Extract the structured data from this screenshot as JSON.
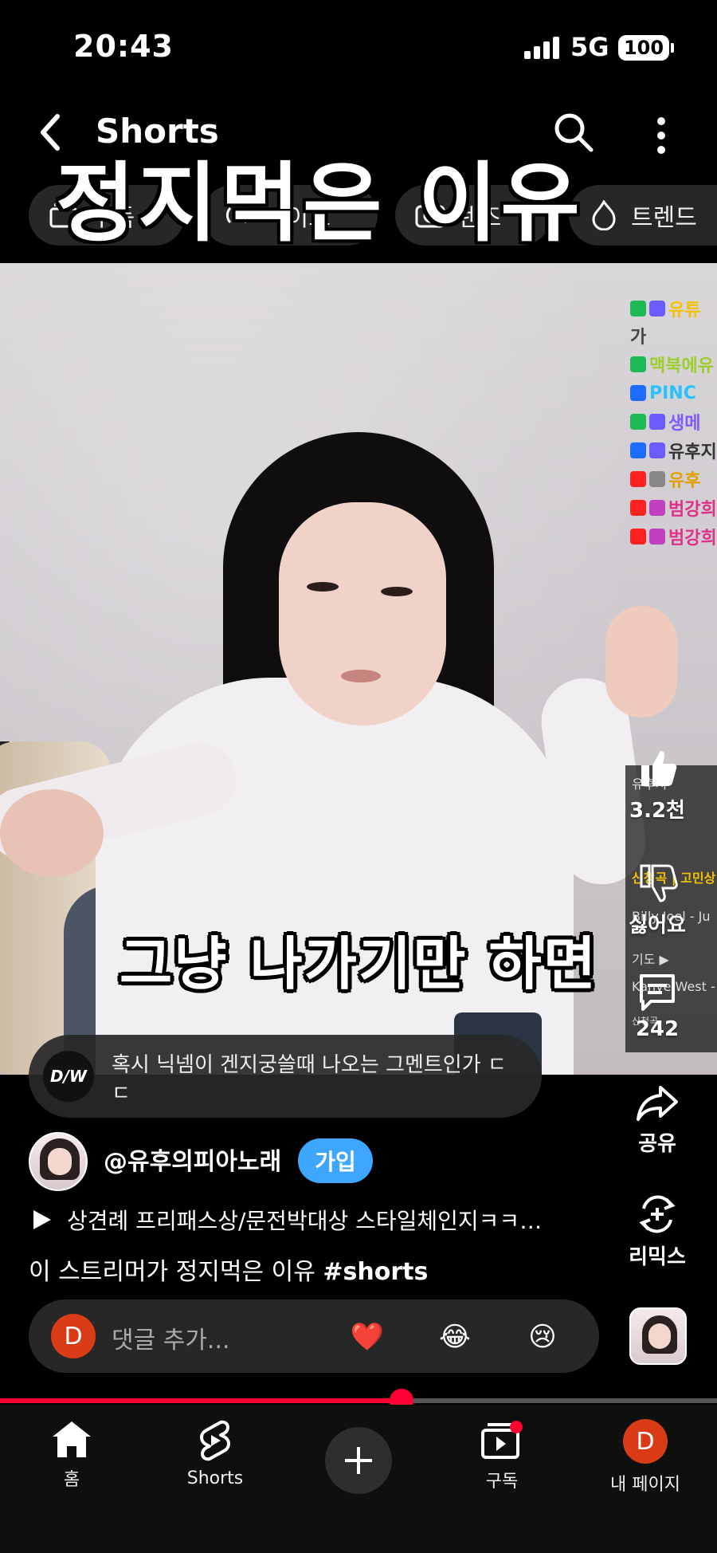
{
  "status_bar": {
    "time": "20:43",
    "network": "5G",
    "battery": "100"
  },
  "header": {
    "title": "Shorts",
    "overlay_title": "정지먹은 이유",
    "chips": [
      {
        "label": "구독",
        "icon": "subscriptions-icon"
      },
      {
        "label": "라이브",
        "icon": "live-icon"
      },
      {
        "label": "렌즈",
        "icon": "lens-icon"
      },
      {
        "label": "트렌드",
        "icon": "trending-icon"
      }
    ]
  },
  "video": {
    "caption": "그냥 나가기만 하면",
    "chat_lines": [
      "유튜",
      "가",
      "맥북에유",
      "PINC",
      "생메",
      "유후지",
      "유후",
      "범강희",
      "범강희"
    ],
    "playlist_lines": [
      "신청곡 | 고민상",
      "Billy Joel - Ju",
      "기도 ▶",
      "Kanye West -",
      "신청곡",
      "유후지"
    ]
  },
  "pinned_comment": {
    "text": "혹시 닉넴이 겐지궁쓸때 나오는 그멘트인가 ㄷ ㄷ"
  },
  "actions": {
    "like_count": "3.2천",
    "dislike_label": "싫어요",
    "comment_count": "242",
    "share_label": "공유",
    "remix_label": "리믹스"
  },
  "channel": {
    "handle": "@유후의피아노래",
    "join_label": "가입"
  },
  "music": {
    "title": "상견례 프리패스상/문전박대상 스타일체인지ㅋㅋ…"
  },
  "description": {
    "text": "이 스트리머가 정지먹은 이유",
    "hashtag": "#shorts"
  },
  "comment_bar": {
    "avatar_letter": "D",
    "placeholder": "댓글 추가...",
    "emojis": [
      "❤️",
      "😂",
      "😢"
    ]
  },
  "progress": {
    "fraction": 0.56
  },
  "bottom_nav": {
    "items": [
      {
        "label": "홈",
        "icon": "home-icon"
      },
      {
        "label": "Shorts",
        "icon": "shorts-icon"
      },
      {
        "label": "",
        "icon": "create-icon"
      },
      {
        "label": "구독",
        "icon": "subscriptions-icon"
      },
      {
        "label": "내 페이지",
        "icon": "avatar"
      }
    ],
    "me_letter": "D"
  },
  "colors": {
    "accent": "#ff0033",
    "join": "#3ea6ff",
    "avatar": "#d93b16"
  }
}
